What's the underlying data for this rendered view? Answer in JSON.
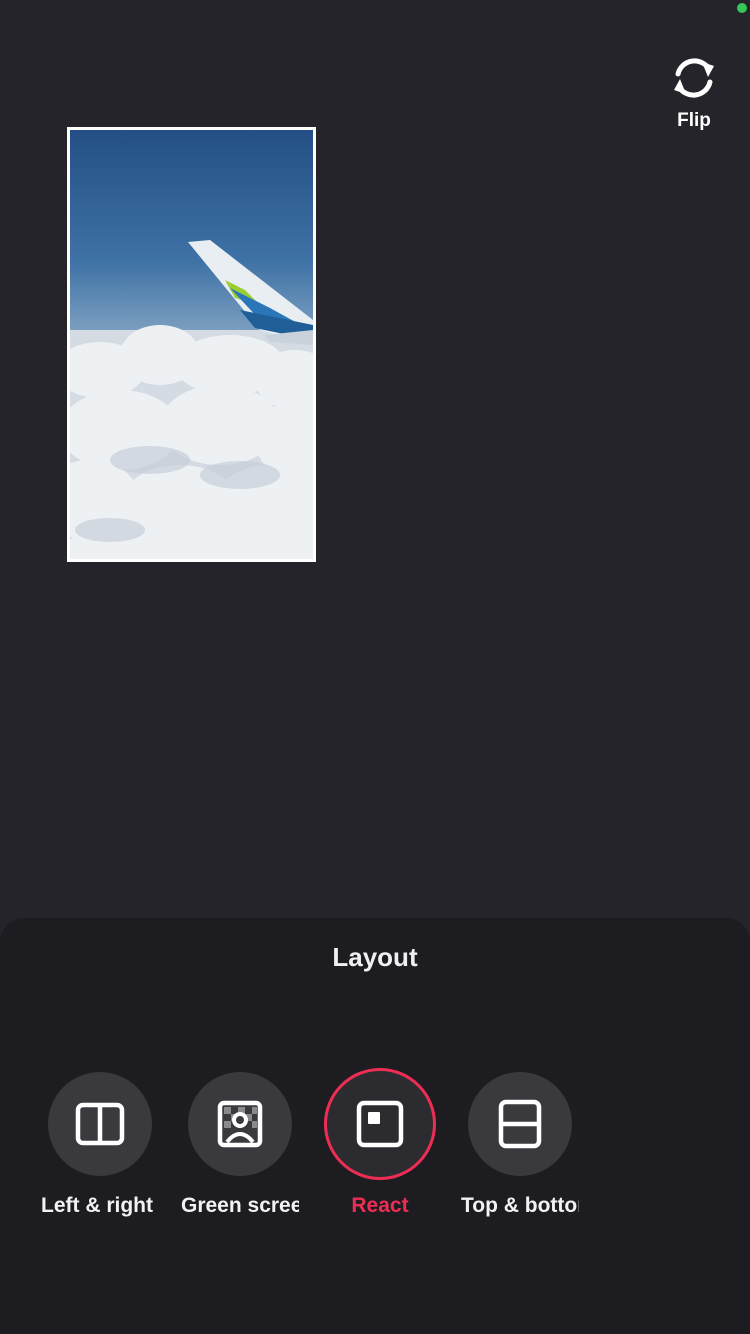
{
  "status": {
    "indicator_color": "#34c759"
  },
  "flip": {
    "label": "Flip",
    "icon": "flip-camera-icon"
  },
  "preview": {
    "icon": "video-preview-airplane-wing-over-clouds"
  },
  "sheet": {
    "title": "Layout",
    "options": [
      {
        "label": "Left & right",
        "icon": "left-right-layout-icon",
        "selected": false
      },
      {
        "label": "Green screen",
        "icon": "green-screen-icon",
        "selected": false
      },
      {
        "label": "React",
        "icon": "react-layout-icon",
        "selected": true
      },
      {
        "label": "Top & bottom",
        "icon": "top-bottom-layout-icon",
        "selected": false
      }
    ]
  },
  "colors": {
    "accent": "#ee2d55",
    "background": "#25242a",
    "sheet": "#1d1c20"
  }
}
